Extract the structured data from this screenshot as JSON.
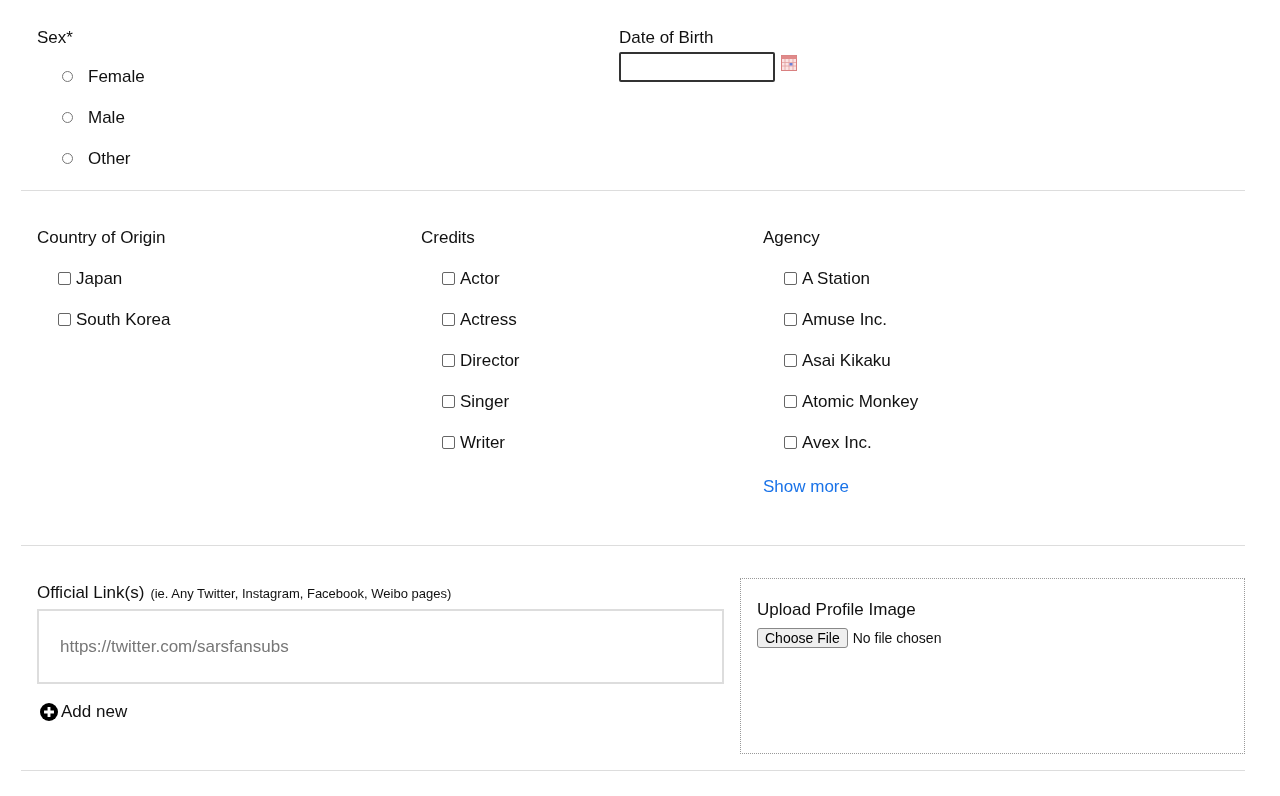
{
  "sex": {
    "label": "Sex*",
    "options": [
      {
        "label": "Female",
        "selected": false
      },
      {
        "label": "Male",
        "selected": false
      },
      {
        "label": "Other",
        "selected": false
      }
    ]
  },
  "date_of_birth": {
    "label": "Date of Birth"
  },
  "filters": [
    {
      "label": "Country of Origin",
      "options": [
        {
          "label": "Japan",
          "checked": false
        },
        {
          "label": "South Korea",
          "checked": false
        }
      ]
    },
    {
      "label": "Credits",
      "options": [
        {
          "label": "Actor",
          "checked": false
        },
        {
          "label": "Actress",
          "checked": false
        },
        {
          "label": "Director",
          "checked": false
        },
        {
          "label": "Singer",
          "checked": false
        },
        {
          "label": "Writer",
          "checked": false
        }
      ]
    },
    {
      "label": "Agency",
      "options": [
        {
          "label": "A Station",
          "checked": false
        },
        {
          "label": "Amuse Inc.",
          "checked": false
        },
        {
          "label": "Asai Kikaku",
          "checked": false
        },
        {
          "label": "Atomic Monkey",
          "checked": false
        },
        {
          "label": "Avex Inc.",
          "checked": false
        }
      ],
      "show_more": "Show more"
    }
  ],
  "official_links": {
    "label": "Official Link(s)",
    "hint": "(ie. Any Twitter, Instagram, Facebook, Weibo pages)",
    "placeholder": "https://twitter.com/sarsfansubs",
    "add_new": "Add new"
  },
  "upload": {
    "label": "Upload Profile Image",
    "button": "Choose File",
    "status": "No file chosen"
  }
}
